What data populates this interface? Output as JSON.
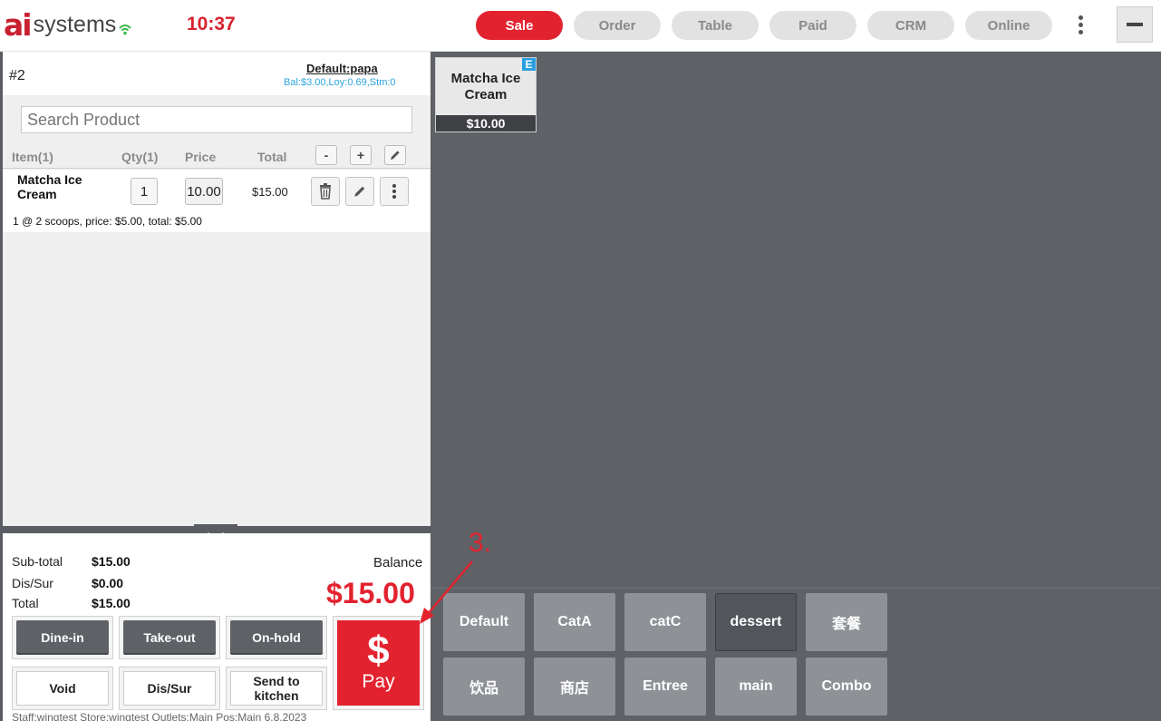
{
  "app": {
    "logo_mark": "ai",
    "logo_text": "systems",
    "clock": "10:37"
  },
  "nav": {
    "tabs": [
      "Sale",
      "Order",
      "Table",
      "Paid",
      "CRM",
      "Online"
    ]
  },
  "order": {
    "number": "#2",
    "customer": "Default:papa",
    "customer_info": "Bal:$3.00,Loy:0.69,Stm:0",
    "search_placeholder": "Search Product",
    "headers": {
      "item": "Item(1)",
      "qty": "Qty(1)",
      "price": "Price",
      "total": "Total",
      "minus": "-",
      "plus": "+"
    },
    "line": {
      "name": "Matcha Ice Cream",
      "qty": "1",
      "price": "10.00",
      "total": "$15.00",
      "note": "1 @ 2 scoops, price: $5.00, total: $5.00"
    }
  },
  "summary": {
    "subtotal_label": "Sub-total",
    "subtotal": "$15.00",
    "dissur_label": "Dis/Sur",
    "dissur": "$0.00",
    "total_label": "Total",
    "total": "$15.00",
    "balance_label": "Balance",
    "balance": "$15.00"
  },
  "actions": {
    "dine_in": "Dine-in",
    "take_out": "Take-out",
    "on_hold": "On-hold",
    "void": "Void",
    "dis_sur": "Dis/Sur",
    "send_kitchen": "Send to kitchen"
  },
  "pay": {
    "symbol": "$",
    "label": "Pay"
  },
  "status_bar": "Staff:wingtest Store:wingtest  Outlets:Main  Pos:Main 6.8.2023",
  "products": [
    {
      "name": "Matcha Ice Cream",
      "price": "$10.00",
      "badge": "E"
    }
  ],
  "categories": [
    "Default",
    "CatA",
    "catC",
    "dessert",
    "套餐",
    "饮品",
    "商店",
    "Entree",
    "main",
    "Combo"
  ],
  "annotation": {
    "label": "3."
  },
  "colors": {
    "accent": "#e3222f",
    "panel": "#5e6166",
    "info": "#2aa3dc"
  }
}
